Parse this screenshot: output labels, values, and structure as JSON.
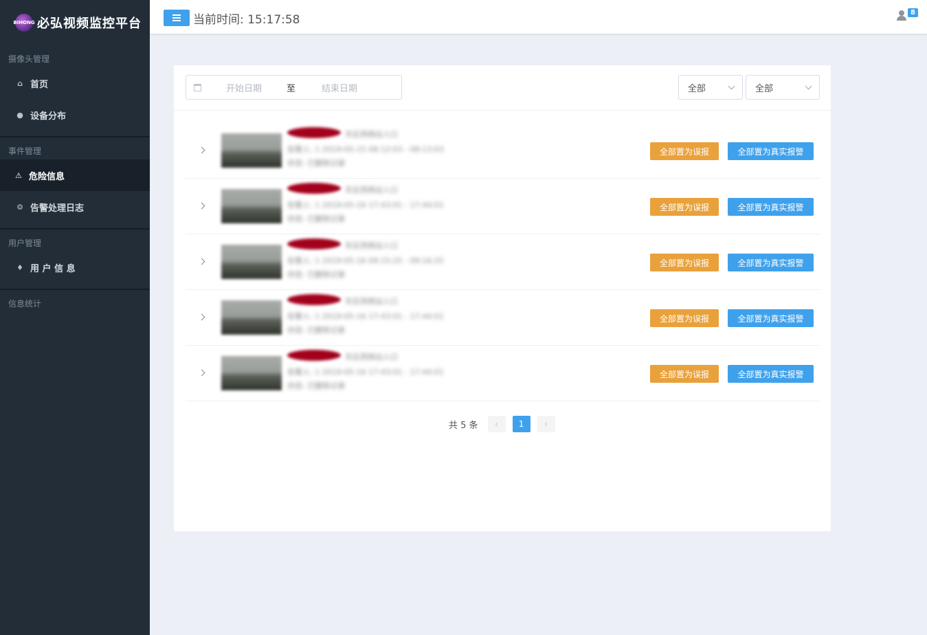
{
  "brand": {
    "title": "必弘视频监控平台",
    "logo_text": "BIHONG"
  },
  "sidebar": {
    "groups": [
      {
        "title": "摄像头管理",
        "items": [
          {
            "label": "首页",
            "icon": "home-icon"
          },
          {
            "label": "设备分布",
            "icon": "map-marker-icon"
          }
        ]
      },
      {
        "title": "事件管理",
        "items": [
          {
            "label": "危险信息",
            "icon": "warning-icon",
            "active": true
          },
          {
            "label": "告警处理日志",
            "icon": "gear-icon"
          }
        ]
      },
      {
        "title": "用户管理",
        "items": [
          {
            "label": "用 户 信 息",
            "icon": "fire-icon"
          }
        ]
      },
      {
        "title": "信息统计",
        "items": []
      }
    ]
  },
  "header": {
    "time_label": "当前时间:",
    "time_value": "15:17:58",
    "user_badge": "8"
  },
  "filters": {
    "start_placeholder": "开始日期",
    "range_separator": "至",
    "end_placeholder": "结束日期",
    "select1_value": "全部",
    "select2_value": "全部"
  },
  "rows": [
    {
      "blur_line1": "东区西侧出入口",
      "blur_line2": "告警人: 1  2019-05-15 08:12:03 - 08:13:03",
      "blur_line3": "状态: 已删除记录"
    },
    {
      "blur_line1": "东区西侧出入口",
      "blur_line2": "告警人: 1  2019-05-16 17:43:01 - 17:44:01",
      "blur_line3": "状态: 已删除记录"
    },
    {
      "blur_line1": "东区西侧出入口",
      "blur_line2": "告警人: 1  2019-05-16 09:15:25 - 09:16:25",
      "blur_line3": "状态: 已删除记录"
    },
    {
      "blur_line1": "东区西侧出入口",
      "blur_line2": "告警人: 1  2019-05-16 17:43:01 - 17:44:01",
      "blur_line3": "状态: 已删除记录"
    },
    {
      "blur_line1": "东区西侧出入口",
      "blur_line2": "告警人: 1  2019-05-16 17:43:01 - 17:44:01",
      "blur_line3": "状态: 已删除记录"
    }
  ],
  "row_actions": {
    "false_alarm": "全部置为误报",
    "true_alarm": "全部置为真实报警"
  },
  "pagination": {
    "total": "共 5 条",
    "current_page": "1",
    "prev_icon": "chevron-left-icon",
    "next_icon": "chevron-right-icon"
  },
  "colors": {
    "sidebar_bg": "#222d38",
    "accent_blue": "#3fa1ec",
    "warning_orange": "#e9a13b",
    "alert_red": "#a2001b"
  }
}
